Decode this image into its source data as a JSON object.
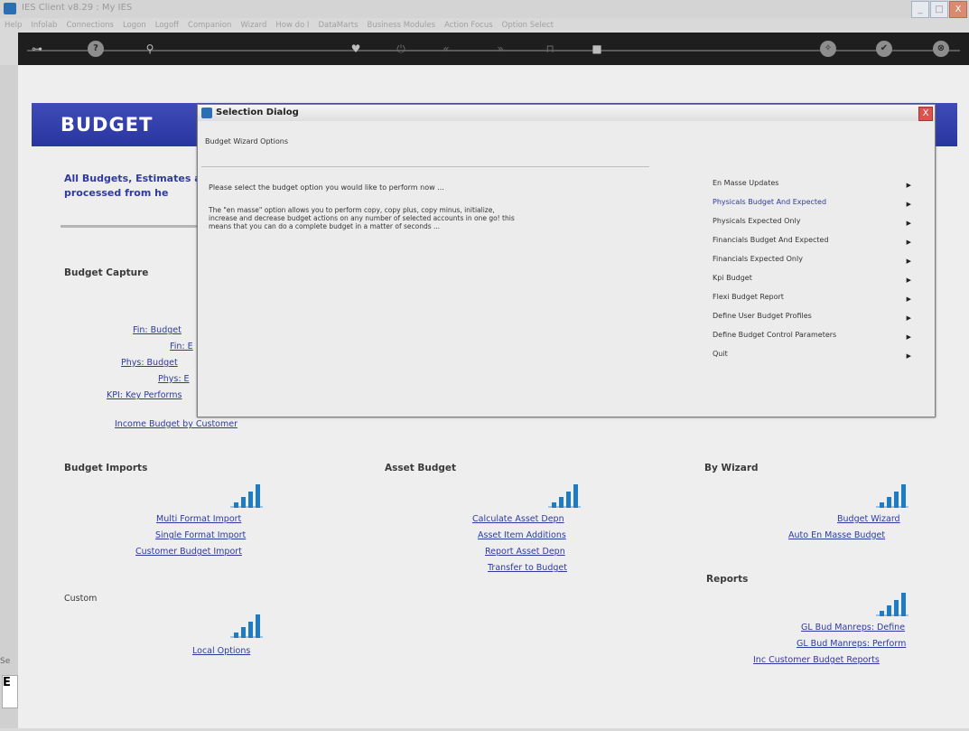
{
  "window": {
    "title": "IES Client v8.29 : My IES",
    "min": "_",
    "max": "□",
    "close": "X"
  },
  "menubar": [
    "Help",
    "Infolab",
    "Connections",
    "Logon",
    "Logoff",
    "Companion",
    "Wizard",
    "How do I",
    "DataMarts",
    "Business Modules",
    "Action Focus",
    "Option Select"
  ],
  "toolbar": {
    "key_icon": "⊶",
    "help_icon": "?",
    "search_icon": "⚲",
    "heart_icon": "♥",
    "power_icon": "⏻",
    "back_icon": "«",
    "fwd_icon": "»",
    "doc_icon": "⊓",
    "stop_icon": "■",
    "refresh_icon": "✧",
    "check_icon": "✔",
    "close_icon": "⊗"
  },
  "page": {
    "banner_title": "BUDGET",
    "intro": "All Budgets, Estimates are processed from he",
    "sections": {
      "capture": "Budget Capture",
      "imports": "Budget Imports",
      "asset": "Asset Budget",
      "wizard": "By Wizard",
      "reports": "Reports",
      "custom": "Custom"
    },
    "capture_links": [
      "Fin: Budget",
      "Fin: E",
      "Phys: Budget",
      "Phys: E",
      "KPI: Key Performs",
      "Income Budget by Customer"
    ],
    "import_links": [
      "Multi Format Import",
      "Single Format Import",
      "Customer Budget Import"
    ],
    "asset_links": [
      "Calculate Asset Depn",
      "Asset Item Additions",
      "Report Asset Depn",
      "Transfer to Budget"
    ],
    "wizard_links": [
      "Budget Wizard",
      "Auto En Masse Budget"
    ],
    "report_links": [
      "GL Bud Manreps: Define",
      "GL Bud Manreps: Perform",
      "Inc Customer Budget Reports"
    ],
    "custom_links": [
      "Local Options"
    ],
    "left_edge_label": "Se",
    "left_edge_box": "E"
  },
  "dialog": {
    "title": "Selection Dialog",
    "subtitle": "Budget Wizard Options",
    "prompt": "Please select the budget option you would like to perform now ...",
    "description": "The \"en masse\" option allows you to perform copy, copy plus, copy minus, initialize, increase and decrease budget actions on any number of selected accounts in one go! this means that you can do a complete budget in a matter of seconds ...",
    "close": "X",
    "options": [
      "En Masse Updates",
      "Physicals Budget And Expected",
      "Physicals Expected Only",
      "Financials Budget And Expected",
      "Financials Expected Only",
      "Kpi Budget",
      "Flexi Budget Report",
      "Define User Budget Profiles",
      "Define Budget Control Parameters",
      "Quit"
    ],
    "highlighted_option": "Physicals Budget And Expected",
    "arrow": "▶"
  },
  "colors": {
    "banner": "#2f3aa0",
    "link": "#2f3aa0",
    "chart_bar": "#1f7bc2",
    "toolbar": "#1e1e1e"
  }
}
